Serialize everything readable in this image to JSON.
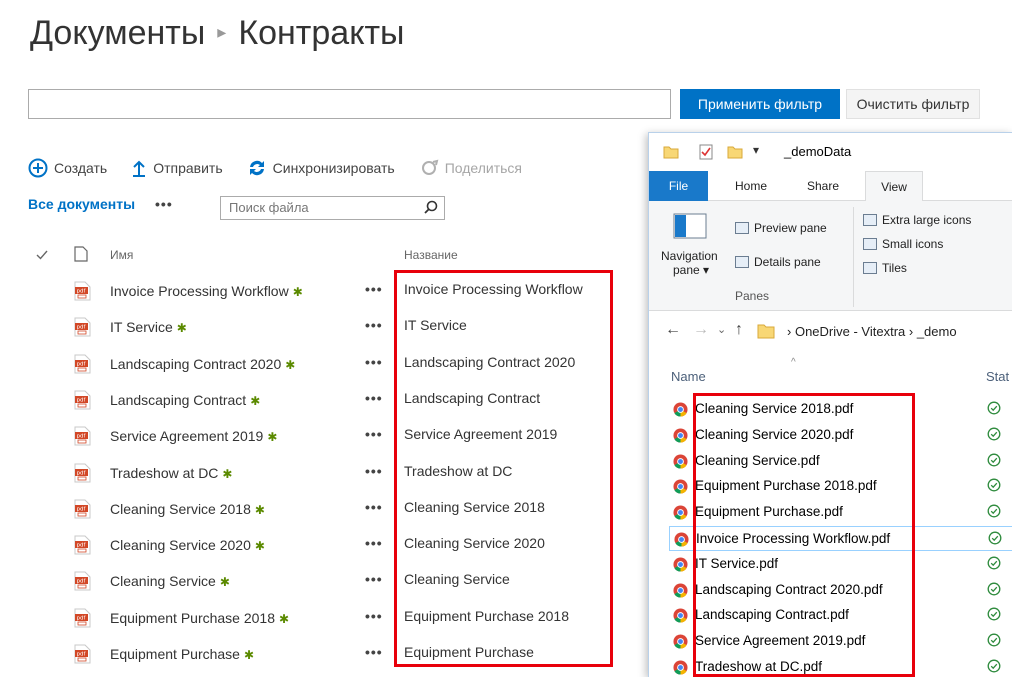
{
  "breadcrumb": {
    "root": "Документы",
    "current": "Контракты"
  },
  "filter": {
    "apply_label": "Применить фильтр",
    "clear_label": "Очистить фильтр",
    "value": ""
  },
  "commands": {
    "create": "Создать",
    "upload": "Отправить",
    "sync": "Синхронизировать",
    "share": "Поделиться"
  },
  "views": {
    "all_documents": "Все документы",
    "more": "•••",
    "search_placeholder": "Поиск файла"
  },
  "columns": {
    "name": "Имя",
    "title": "Название"
  },
  "documents": [
    {
      "name": "Invoice Processing Workflow",
      "title": "Invoice Processing Workflow"
    },
    {
      "name": "IT Service",
      "title": "IT Service"
    },
    {
      "name": "Landscaping Contract 2020",
      "title": "Landscaping Contract 2020"
    },
    {
      "name": "Landscaping Contract",
      "title": "Landscaping Contract"
    },
    {
      "name": "Service Agreement 2019",
      "title": "Service Agreement 2019"
    },
    {
      "name": "Tradeshow at DC",
      "title": "Tradeshow at DC"
    },
    {
      "name": "Cleaning Service 2018",
      "title": "Cleaning Service 2018"
    },
    {
      "name": "Cleaning Service 2020",
      "title": "Cleaning Service 2020"
    },
    {
      "name": "Cleaning Service",
      "title": "Cleaning Service"
    },
    {
      "name": "Equipment Purchase 2018",
      "title": "Equipment Purchase 2018"
    },
    {
      "name": "Equipment Purchase",
      "title": "Equipment Purchase"
    }
  ],
  "new_marker": "✱",
  "row_menu": "•••",
  "explorer": {
    "window_title": "_demoData",
    "tabs": {
      "file": "File",
      "home": "Home",
      "share": "Share",
      "view": "View"
    },
    "ribbon": {
      "navigation_pane": "Navigation",
      "navigation_pane_2": "pane ▾",
      "preview_pane": "Preview pane",
      "details_pane": "Details pane",
      "panes_group": "Panes",
      "extra_large_icons": "Extra large icons",
      "small_icons": "Small icons",
      "tiles": "Tiles"
    },
    "address": {
      "seg1": "OneDrive - Vitextra",
      "seg2": "_demo"
    },
    "columns": {
      "name": "Name",
      "status": "Stat"
    },
    "files": [
      "Cleaning Service 2018.pdf",
      "Cleaning Service 2020.pdf",
      "Cleaning Service.pdf",
      "Equipment Purchase 2018.pdf",
      "Equipment Purchase.pdf",
      "Invoice Processing Workflow.pdf",
      "IT Service.pdf",
      "Landscaping Contract 2020.pdf",
      "Landscaping Contract.pdf",
      "Service Agreement 2019.pdf",
      "Tradeshow at DC.pdf"
    ],
    "selected_index": 5
  },
  "colors": {
    "accent": "#0072c6",
    "highlight": "#e8000b",
    "new_marker": "#5b8a00",
    "sync_ok": "#2e8b3d"
  }
}
